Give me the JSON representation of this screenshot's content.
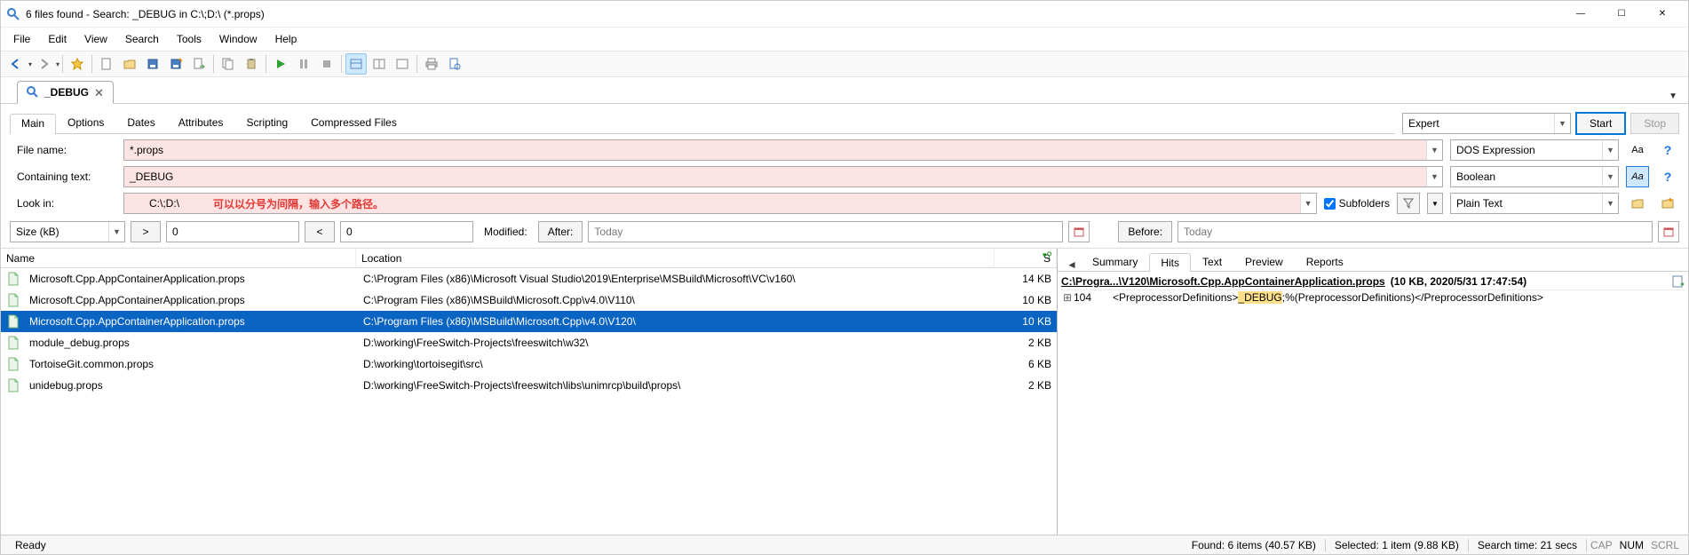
{
  "window": {
    "title": "6 files found - Search: _DEBUG in C:\\;D:\\ (*.props)"
  },
  "menu": [
    "File",
    "Edit",
    "View",
    "Search",
    "Tools",
    "Window",
    "Help"
  ],
  "doctab": {
    "label": "_DEBUG"
  },
  "form_tabs": [
    "Main",
    "Options",
    "Dates",
    "Attributes",
    "Scripting",
    "Compressed Files"
  ],
  "expert_label": "Expert",
  "buttons": {
    "start": "Start",
    "stop": "Stop"
  },
  "fields": {
    "file_name_label": "File name:",
    "file_name_value": "*.props",
    "file_name_engine": "DOS Expression",
    "containing_label": "Containing text:",
    "containing_value": "_DEBUG",
    "containing_engine": "Boolean",
    "lookin_label": "Look in:",
    "lookin_value": "C:\\;D:\\",
    "lookin_annot": "可以以分号为间隔，输入多个路径。",
    "lookin_engine": "Plain Text",
    "subfolders_label": "Subfolders"
  },
  "modified": {
    "size_label": "Size (kB)",
    "gt": ">",
    "lt": "<",
    "gt_val": "0",
    "lt_val": "0",
    "modified_label": "Modified:",
    "after_label": "After:",
    "before_label": "Before:",
    "after_val": "Today",
    "before_val": "Today"
  },
  "columns": {
    "name": "Name",
    "location": "Location",
    "size": "S"
  },
  "results": [
    {
      "name": "Microsoft.Cpp.AppContainerApplication.props",
      "location": "C:\\Program Files (x86)\\Microsoft Visual Studio\\2019\\Enterprise\\MSBuild\\Microsoft\\VC\\v160\\",
      "size": "14 KB",
      "selected": false
    },
    {
      "name": "Microsoft.Cpp.AppContainerApplication.props",
      "location": "C:\\Program Files (x86)\\MSBuild\\Microsoft.Cpp\\v4.0\\V110\\",
      "size": "10 KB",
      "selected": false
    },
    {
      "name": "Microsoft.Cpp.AppContainerApplication.props",
      "location": "C:\\Program Files (x86)\\MSBuild\\Microsoft.Cpp\\v4.0\\V120\\",
      "size": "10 KB",
      "selected": true
    },
    {
      "name": "module_debug.props",
      "location": "D:\\working\\FreeSwitch-Projects\\freeswitch\\w32\\",
      "size": "2 KB",
      "selected": false
    },
    {
      "name": "TortoiseGit.common.props",
      "location": "D:\\working\\tortoisegit\\src\\",
      "size": "6 KB",
      "selected": false
    },
    {
      "name": "unidebug.props",
      "location": "D:\\working\\FreeSwitch-Projects\\freeswitch\\libs\\unimrcp\\build\\props\\",
      "size": "2 KB",
      "selected": false
    }
  ],
  "preview_tabs": [
    "Summary",
    "Hits",
    "Text",
    "Preview",
    "Reports"
  ],
  "preview_active": "Hits",
  "preview_file": {
    "path": "C:\\Progra...\\V120\\Microsoft.Cpp.AppContainerApplication.props",
    "meta": "(10 KB,  2020/5/31 17:47:54)"
  },
  "hit": {
    "line": "104",
    "pre": "<PreprocessorDefinitions>",
    "match": "_DEBUG",
    "post": ";%(PreprocessorDefinitions)</PreprocessorDefinitions>"
  },
  "status": {
    "ready": "Ready",
    "found": "Found: 6 items (40.57 KB)",
    "selected": "Selected: 1 item (9.88 KB)",
    "time": "Search time: 21 secs",
    "cap": "CAP",
    "num": "NUM",
    "scrl": "SCRL"
  }
}
